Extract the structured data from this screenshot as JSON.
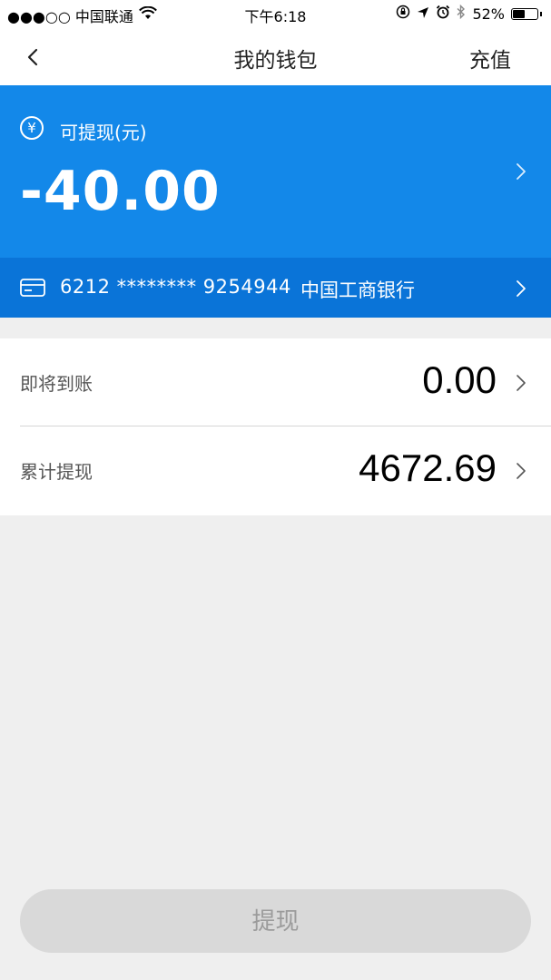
{
  "status_bar": {
    "carrier": "●●●○○ 中国联通",
    "time": "下午6:18",
    "battery": "52%",
    "battery_level": 0.52,
    "icons": [
      "wifi-icon",
      "orientation-lock-icon",
      "location-icon",
      "alarm-icon",
      "bluetooth-icon",
      "battery-icon"
    ]
  },
  "nav": {
    "title": "我的钱包",
    "action": "充值",
    "back_icon": "chevron-left-icon"
  },
  "balance": {
    "label": "可提现(元)",
    "value": "-40.00",
    "currency_symbol": "¥"
  },
  "bank": {
    "card_number": "6212 ******** 9254944",
    "bank_name": "中国工商银行",
    "icon": "credit-card-icon"
  },
  "list": {
    "items": [
      {
        "label": "即将到账",
        "value": "0.00"
      },
      {
        "label": "累计提现",
        "value": "4672.69"
      }
    ]
  },
  "withdraw_button": {
    "label": "提现"
  },
  "colors": {
    "primary_blue": "#1388e9",
    "bank_row_blue": "#0a74d8",
    "page_background": "#efefef",
    "disabled_button": "#d9d9d9"
  }
}
